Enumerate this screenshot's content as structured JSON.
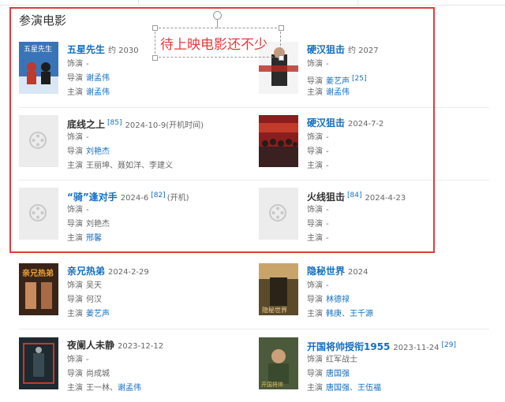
{
  "section_title": "参演电影",
  "annotation": {
    "text": "待上映电影还不少"
  },
  "labels": {
    "role": "饰演",
    "director": "导演",
    "cast": "主演",
    "dash": "-"
  },
  "films": [
    {
      "title": "五星先生",
      "year": "约 2030",
      "role": "-",
      "director": [
        "谢孟伟"
      ],
      "cast": [
        "谢孟伟"
      ],
      "poster": "poster-five-star"
    },
    {
      "title": "硬汉狙击",
      "year": "约 2027",
      "role": "-",
      "director": [
        "姜艺声"
      ],
      "director_cite": "[25]",
      "cast": [
        "谢孟伟"
      ],
      "poster": "poster-tough-sniper"
    },
    {
      "title": "底线之上",
      "cite": "[85]",
      "year": "2024-10-9(开机时间)",
      "role": "-",
      "director": [
        "刘艳杰"
      ],
      "cast_plain": "王丽坤、聂如洋、李建义",
      "poster": "placeholder",
      "dark": true
    },
    {
      "title": "硬汉狙击",
      "year": "2024-7-2",
      "role": "-",
      "director_text": "-",
      "cast_text": "-",
      "poster": "poster-crowd"
    },
    {
      "title": "“骑”逢对手",
      "year": "2024-6",
      "cite": "[82]",
      "sub": "(开机)",
      "role": "-",
      "director_plain": "刘艳杰",
      "cast": [
        "邢馨"
      ],
      "poster": "placeholder"
    },
    {
      "title": "火线狙击",
      "cite": "[84]",
      "year": "2024-4-23",
      "role": "-",
      "director_text": "-",
      "cast_text": "-",
      "poster": "placeholder",
      "dark": true
    },
    {
      "title": "亲兄热弟",
      "year": "2024-2-29",
      "role": "吴天",
      "director_plain": "何汉",
      "cast": [
        "姜艺声"
      ],
      "poster": "poster-brothers"
    },
    {
      "title": "隐秘世界",
      "year": "2024",
      "role": "-",
      "director": [
        "林德禄"
      ],
      "cast": [
        "韩庚",
        "王千源"
      ],
      "poster": "poster-hidden-world"
    },
    {
      "title": "夜阑人未静",
      "year": "2023-12-12",
      "role": "-",
      "director_plain": "尚成城",
      "cast_mixed": [
        "王一林、",
        "谢孟伟"
      ],
      "poster": "poster-night",
      "dark": true
    },
    {
      "title": "开国将帅授衔1955",
      "year": "2023-11-24",
      "cite": "[29]",
      "role": "红军战士",
      "director": [
        "唐国强"
      ],
      "cast": [
        "唐国强",
        "王伍福"
      ],
      "poster": "poster-generals"
    }
  ]
}
